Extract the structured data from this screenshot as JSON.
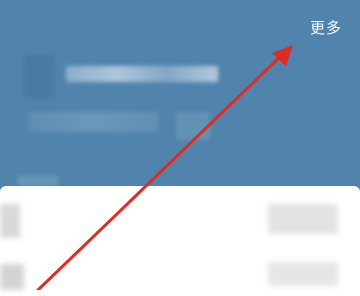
{
  "header": {
    "more_label": "更多"
  },
  "colors": {
    "header_bg": "#5084ad",
    "sheet_bg": "#ffffff",
    "annotation_arrow": "#e02a22"
  }
}
